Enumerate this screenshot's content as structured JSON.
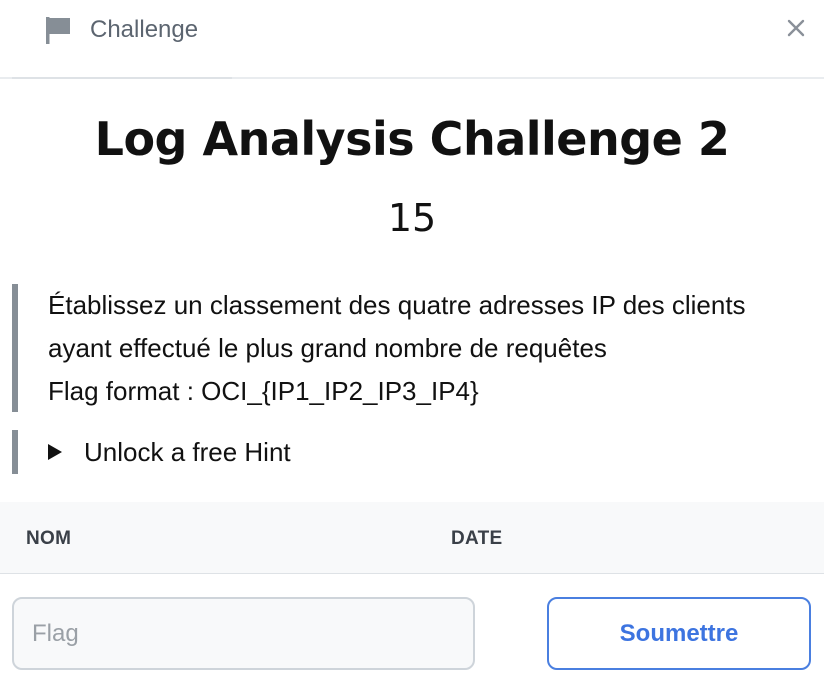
{
  "header": {
    "tab_label": "Challenge",
    "tab_icon": "flag-icon",
    "close_icon": "close-icon"
  },
  "challenge": {
    "title": "Log Analysis Challenge 2",
    "points": "15",
    "description": {
      "line1": "Établissez un classement des quatre adresses IP des clients",
      "line2": "ayant effectué le plus grand nombre de requêtes",
      "line3": "Flag format : OCI_{IP1_IP2_IP3_IP4}"
    },
    "hint_label": "Unlock a free Hint"
  },
  "solves_table": {
    "columns": [
      "NOM",
      "DATE"
    ]
  },
  "submit": {
    "placeholder": "Flag",
    "value": "",
    "button_label": "Soumettre"
  },
  "colors": {
    "accent": "#3d74e0",
    "border_bar": "#868e96",
    "table_header_bg": "#f8f9fa"
  }
}
